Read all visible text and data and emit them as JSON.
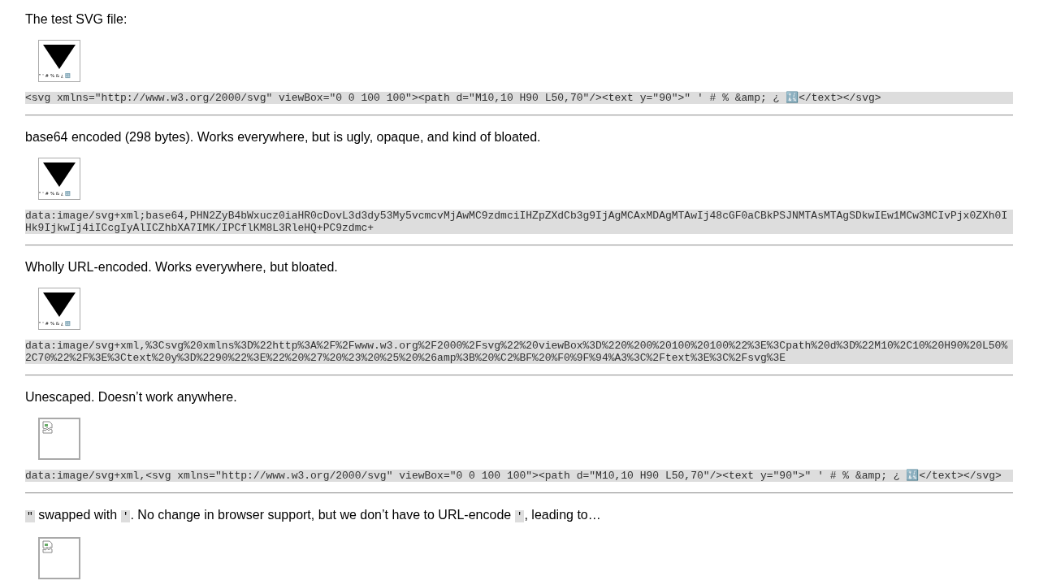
{
  "sections": [
    {
      "paragraph": [
        {
          "kind": "text",
          "text": "The test SVG file:"
        }
      ],
      "image": {
        "kind": "svg",
        "caption": "\" ' # % & ¿ 🔣"
      },
      "code": "<svg xmlns=\"http://www.w3.org/2000/svg\" viewBox=\"0 0 100 100\"><path d=\"M10,10 H90 L50,70\"/><text y=\"90\">\" ' # % &amp; ¿ 🔣</text></svg>"
    },
    {
      "paragraph": [
        {
          "kind": "text",
          "text": "base64 encoded (298 bytes). Works everywhere, but is ugly, opaque, and kind of bloated."
        }
      ],
      "image": {
        "kind": "svg",
        "caption": "\" ' # % & ¿ 🔣"
      },
      "code": "data:image/svg+xml;base64,PHN2ZyB4bWxucz0iaHR0cDovL3d3dy53My5vcmcvMjAwMC9zdmciIHZpZXdCb3g9IjAgMCAxMDAgMTAwIj48cGF0aCBkPSJNMTAsMTAgSDkwIEw1MCw3MCIvPjx0ZXh0IHk9IjkwIj4iICcgIyAlICZhbXA7IMK/IPCflKM8L3RleHQ+PC9zdmc+"
    },
    {
      "paragraph": [
        {
          "kind": "text",
          "text": "Wholly URL-encoded. Works everywhere, but bloated."
        }
      ],
      "image": {
        "kind": "svg",
        "caption": "\" ' # % & ¿ 🔣"
      },
      "code": "data:image/svg+xml,%3Csvg%20xmlns%3D%22http%3A%2F%2Fwww.w3.org%2F2000%2Fsvg%22%20viewBox%3D%220%200%20100%20100%22%3E%3Cpath%20d%3D%22M10%2C10%20H90%20L50%2C70%22%2F%3E%3Ctext%20y%3D%2290%22%3E%22%20%27%20%23%20%25%20%26amp%3B%20%C2%BF%20%F0%9F%94%A3%3C%2Ftext%3E%3C%2Fsvg%3E"
    },
    {
      "paragraph": [
        {
          "kind": "text",
          "text": "Unescaped. Doesn’t work anywhere."
        }
      ],
      "image": {
        "kind": "broken"
      },
      "code": "data:image/svg+xml,<svg xmlns=\"http://www.w3.org/2000/svg\" viewBox=\"0 0 100 100\"><path d=\"M10,10 H90 L50,70\"/><text y=\"90\">\" ' # % &amp; ¿ 🔣</text></svg>"
    },
    {
      "paragraph": [
        {
          "kind": "code",
          "text": "\""
        },
        {
          "kind": "text",
          "text": " swapped with "
        },
        {
          "kind": "code",
          "text": "'"
        },
        {
          "kind": "text",
          "text": ". No change in browser support, but we don’t have to URL-encode "
        },
        {
          "kind": "code",
          "text": "'"
        },
        {
          "kind": "text",
          "text": ", leading to…"
        }
      ],
      "image": {
        "kind": "broken"
      }
    }
  ]
}
